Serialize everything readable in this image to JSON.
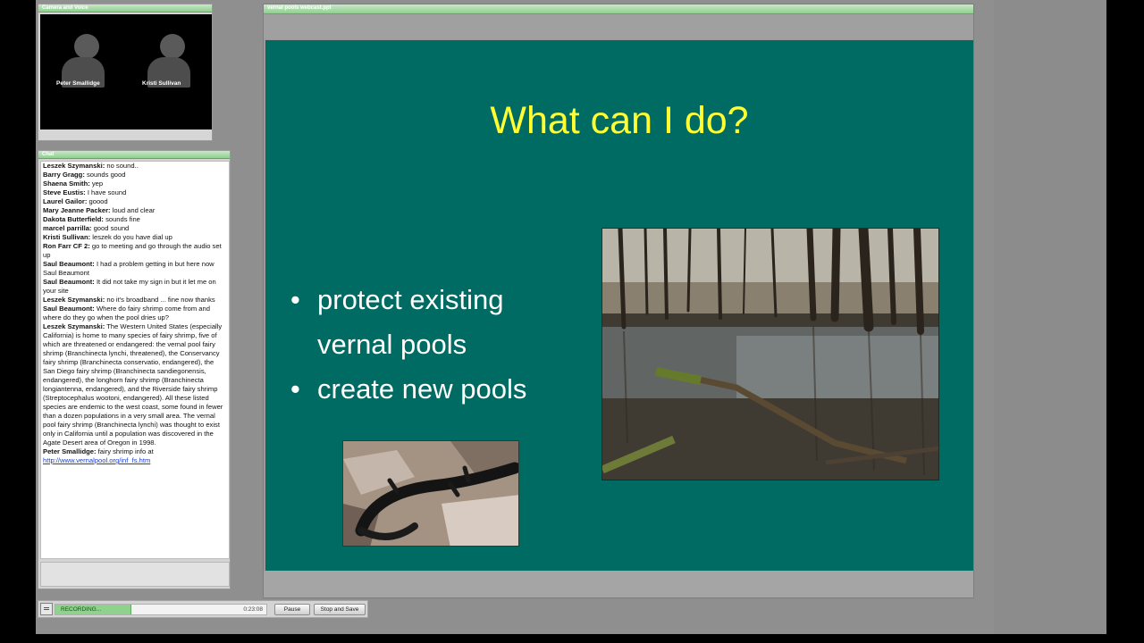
{
  "camera_pod": {
    "title": "Camera and Voice",
    "participants": [
      {
        "name": "Peter Smallidge"
      },
      {
        "name": "Kristi Sullivan"
      }
    ]
  },
  "chat_pod": {
    "title": "Chat",
    "messages": [
      {
        "sender": "Leszek Szymanski:",
        "text": "no sound.."
      },
      {
        "sender": "Barry Gragg:",
        "text": "sounds good"
      },
      {
        "sender": "Shaena Smith:",
        "text": "yep"
      },
      {
        "sender": "Steve Eustis:",
        "text": "I have sound"
      },
      {
        "sender": "Laurel Gailor:",
        "text": "goood"
      },
      {
        "sender": "Mary Jeanne Packer:",
        "text": "loud and clear"
      },
      {
        "sender": "Dakota Butterfield:",
        "text": "sounds fine"
      },
      {
        "sender": "marcel parrilla:",
        "text": "good sound"
      },
      {
        "sender": "Kristi Sullivan:",
        "text": "leszek do you have dial up"
      },
      {
        "sender": "Ron Farr CF 2:",
        "text": "go to meeting and go through the audio set up"
      },
      {
        "sender": "Saul Beaumont:",
        "text": "I had a problem getting in but here now  Saul Beaumont"
      },
      {
        "sender": "Saul Beaumont:",
        "text": "It did not take my sign in but it let me on your site"
      },
      {
        "sender": "Leszek Szymanski:",
        "text": "no it's broadband ... fine now thanks"
      },
      {
        "sender": "Saul Beaumont:",
        "text": "Where do fairy shrimp come from and where do they go when the pool dries up?"
      },
      {
        "sender": "Leszek Szymanski:",
        "text": "The Western United States (especially California) is home to many species of fairy shrimp, five of which are threatened or endangered: the vernal pool fairy shrimp (Branchinecta lynchi, threatened), the Conservancy fairy shrimp (Branchinecta conservatio, endangered), the San Diego fairy shrimp (Branchinecta sandiegonensis, endangered), the longhorn fairy shrimp (Branchinecta longiantenna, endangered), and the Riverside fairy shrimp (Streptocephalus wootoni, endangered). All these listed species are endemic to the west coast, some found in fewer than a dozen populations in a very small area. The vernal pool fairy shrimp (Branchinecta lynchi) was thought to exist only in California until a population was discovered in the Agate Desert area of Oregon in 1998."
      },
      {
        "sender": "Peter Smallidge:",
        "text": "fairy shrimp info at"
      }
    ],
    "link": "http://www.vernalpool.org/inf_fs.htm"
  },
  "share_pod": {
    "title": "vernal pools webcast.ppt",
    "slide": {
      "title": "What can I do?",
      "bullet_char": "•",
      "bullets": [
        {
          "line1": "protect existing",
          "line2": "vernal pools"
        },
        {
          "line1": "create new pools"
        }
      ]
    }
  },
  "recording_bar": {
    "status": "RECORDING...",
    "elapsed": "0:23:08",
    "progress": 0.36,
    "pause_label": "Pause",
    "stop_label": "Stop and Save"
  },
  "colors": {
    "slide_background": "#006b63",
    "slide_title": "#ffff33",
    "pod_header": "#8fcf8f",
    "link": "#1a3fd1"
  },
  "icons": [
    "participant-silhouette-icon",
    "menu-icon"
  ]
}
